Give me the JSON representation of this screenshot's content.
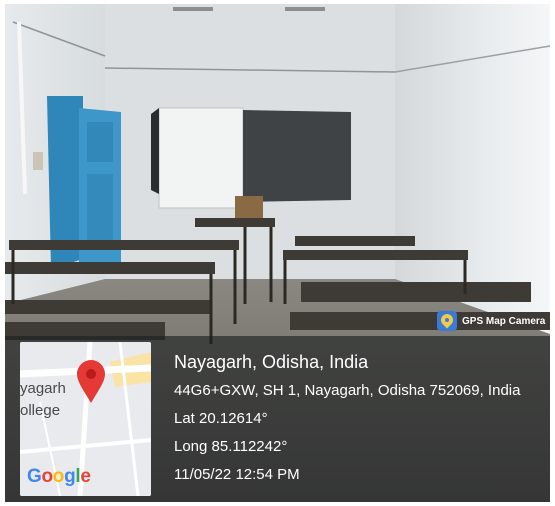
{
  "badge": {
    "label": "GPS Map Camera",
    "icon": "gps-map-camera-icon"
  },
  "map": {
    "label_line1": "yagarh",
    "label_line2": "ollege",
    "logo": "Google",
    "pin_icon": "map-pin-icon",
    "pin_color": "#e53935"
  },
  "location": {
    "title": "Nayagarh, Odisha, India",
    "address": "44G6+GXW, SH 1, Nayagarh, Odisha 752069, India",
    "lat": "Lat 20.12614°",
    "long": "Long 85.112242°",
    "datetime": "11/05/22 12:54 PM"
  }
}
